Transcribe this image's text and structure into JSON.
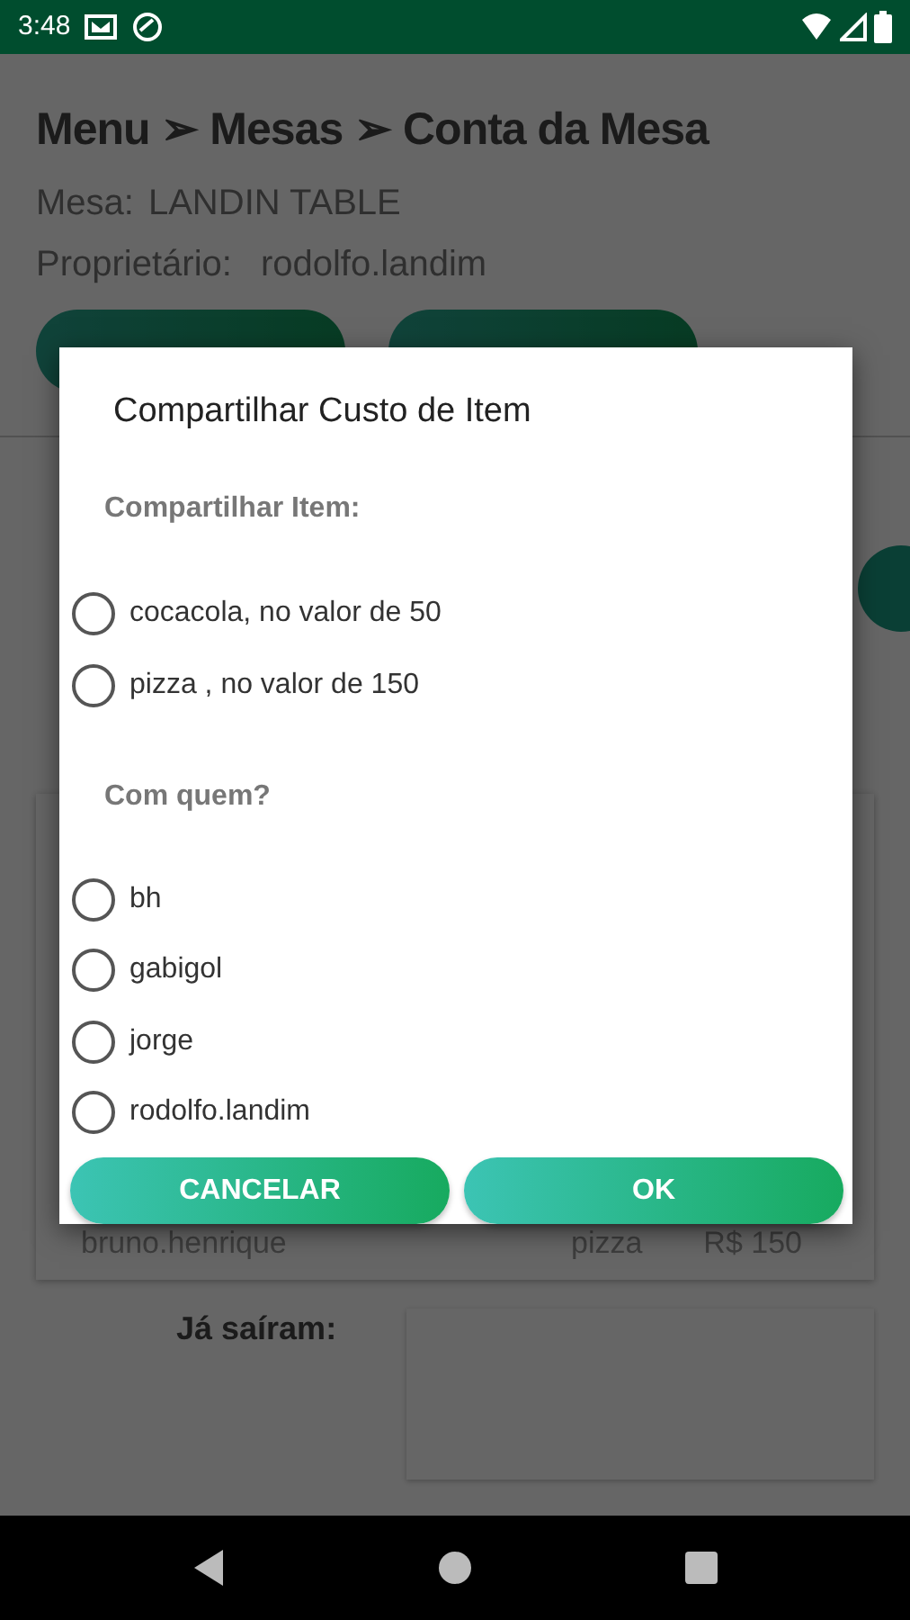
{
  "status_bar": {
    "time": "3:48"
  },
  "header": {
    "title": "Menu ➢ Mesas ➢ Conta da Mesa",
    "table_label": "Mesa:",
    "table_name": "LANDIN TABLE",
    "owner_label": "Proprietário:",
    "owner": "rodolfo.landim"
  },
  "orders": [
    {
      "person": "bruno.henrique",
      "item": "pizza",
      "price": "R$ 150"
    }
  ],
  "left_label": "Já saíram:",
  "dialog": {
    "title": "Compartilhar Custo de Item",
    "item_label": "Compartilhar Item:",
    "items": [
      {
        "label": "cocacola, no valor de 50",
        "selected": false
      },
      {
        "label": "pizza , no valor de 150",
        "selected": false
      }
    ],
    "people_label": "Com quem?",
    "people": [
      {
        "label": "bh",
        "selected": false
      },
      {
        "label": "gabigol",
        "selected": false
      },
      {
        "label": "jorge",
        "selected": false
      },
      {
        "label": "rodolfo.landim",
        "selected": false
      }
    ],
    "buttons": [
      "CANCELAR",
      "OK"
    ]
  }
}
